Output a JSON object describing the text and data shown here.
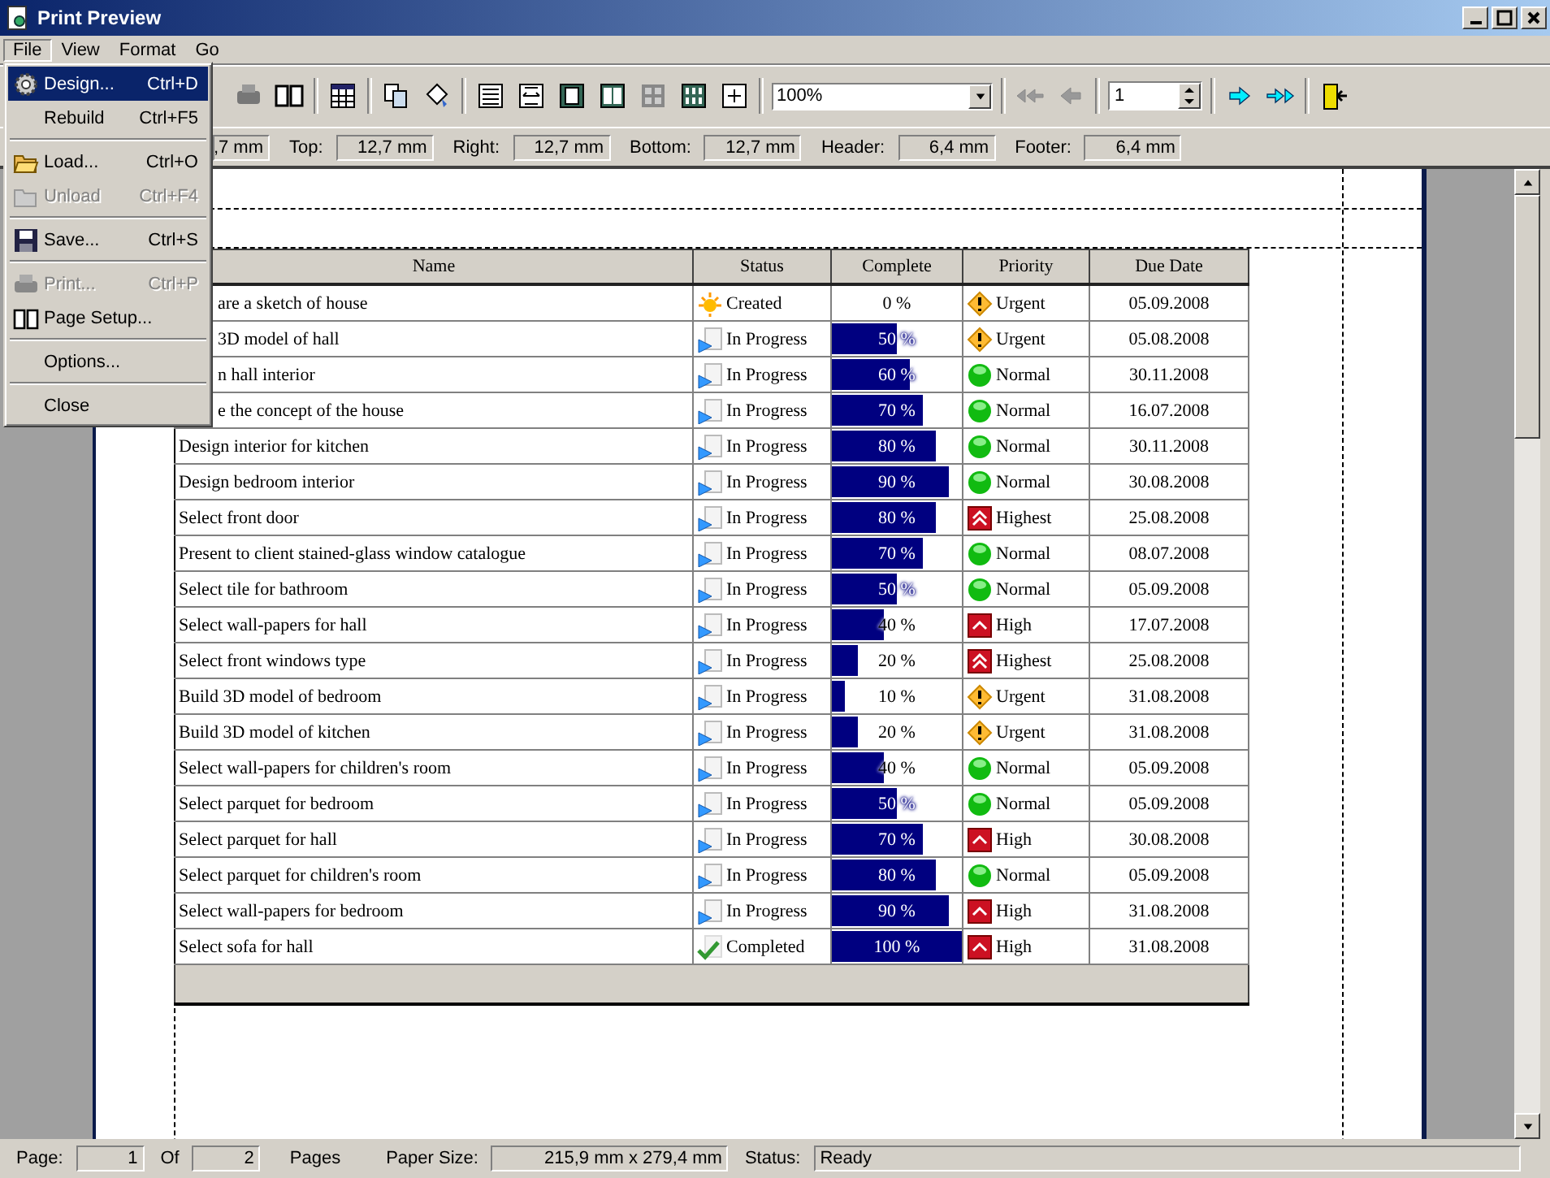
{
  "window": {
    "title": "Print Preview"
  },
  "menu_bar": [
    {
      "label": "File",
      "selected": true
    },
    {
      "label": "View",
      "selected": false
    },
    {
      "label": "Format",
      "selected": false
    },
    {
      "label": "Go",
      "selected": false
    }
  ],
  "file_menu": [
    {
      "label": "Design...",
      "shortcut": "Ctrl+D",
      "selected": true,
      "disabled": false,
      "separator_after": false
    },
    {
      "label": "Rebuild",
      "shortcut": "Ctrl+F5",
      "selected": false,
      "disabled": false,
      "separator_after": true
    },
    {
      "label": "Load...",
      "shortcut": "Ctrl+O",
      "selected": false,
      "disabled": false,
      "separator_after": false
    },
    {
      "label": "Unload",
      "shortcut": "Ctrl+F4",
      "selected": false,
      "disabled": true,
      "separator_after": true
    },
    {
      "label": "Save...",
      "shortcut": "Ctrl+S",
      "selected": false,
      "disabled": false,
      "separator_after": true
    },
    {
      "label": "Print...",
      "shortcut": "Ctrl+P",
      "selected": false,
      "disabled": true,
      "separator_after": false
    },
    {
      "label": "Page Setup...",
      "selected": false,
      "disabled": false,
      "separator_after": true
    },
    {
      "label": "Options...",
      "selected": false,
      "disabled": false,
      "separator_after": true
    },
    {
      "label": "Close",
      "selected": false,
      "disabled": false,
      "separator_after": false
    }
  ],
  "toolbar": {
    "zoom": "100%",
    "page": "1",
    "nav_buttons": [
      {
        "disabled": true
      },
      {
        "disabled": true
      },
      {
        "disabled": false
      },
      {
        "disabled": false
      }
    ]
  },
  "margins": [
    {
      "value": ",7 mm"
    },
    {
      "label": "Top:",
      "value": "12,7 mm"
    },
    {
      "label": "Right:",
      "value": "12,7 mm"
    },
    {
      "label": "Bottom:",
      "value": "12,7 mm"
    },
    {
      "label": "Header:",
      "value": "6,4 mm"
    },
    {
      "label": "Footer:",
      "value": "6,4 mm"
    }
  ],
  "table": {
    "columns": [
      "Name",
      "Status",
      "Complete",
      "Priority",
      "Due Date"
    ],
    "rows": [
      {
        "name": "are a sketch of house",
        "name_covered": true,
        "status": {
          "kind": "created",
          "label": "Created"
        },
        "complete": "0 %",
        "level": 0,
        "priority": {
          "kind": "urgent",
          "label": "Urgent"
        },
        "due": "05.09.2008"
      },
      {
        "name": "3D model of hall",
        "name_covered": true,
        "status": {
          "kind": "progress",
          "label": "In Progress"
        },
        "complete": "50 %",
        "level": 0.5,
        "priority": {
          "kind": "urgent",
          "label": "Urgent"
        },
        "due": "05.08.2008"
      },
      {
        "name": "n hall interior",
        "name_covered": true,
        "status": {
          "kind": "progress",
          "label": "In Progress"
        },
        "complete": "60 %",
        "level": 0.6,
        "priority": {
          "kind": "normal",
          "label": "Normal"
        },
        "due": "30.11.2008"
      },
      {
        "name": "e the concept of the house",
        "name_covered": true,
        "status": {
          "kind": "progress",
          "label": "In Progress"
        },
        "complete": "70 %",
        "level": 0.7,
        "priority": {
          "kind": "normal",
          "label": "Normal"
        },
        "due": "16.07.2008"
      },
      {
        "name": "Design interior for kitchen",
        "name_covered": false,
        "status": {
          "kind": "progress",
          "label": "In Progress"
        },
        "complete": "80 %",
        "level": 0.8,
        "priority": {
          "kind": "normal",
          "label": "Normal"
        },
        "due": "30.11.2008"
      },
      {
        "name": "Design bedroom interior",
        "name_covered": false,
        "status": {
          "kind": "progress",
          "label": "In Progress"
        },
        "complete": "90 %",
        "level": 0.9,
        "priority": {
          "kind": "normal",
          "label": "Normal"
        },
        "due": "30.08.2008"
      },
      {
        "name": "Select front door",
        "name_covered": false,
        "status": {
          "kind": "progress",
          "label": "In Progress"
        },
        "complete": "80 %",
        "level": 0.8,
        "priority": {
          "kind": "highest",
          "label": "Highest"
        },
        "due": "25.08.2008"
      },
      {
        "name": "Present to client stained-glass window catalogue",
        "name_covered": false,
        "status": {
          "kind": "progress",
          "label": "In Progress"
        },
        "complete": "70 %",
        "level": 0.7,
        "priority": {
          "kind": "normal",
          "label": "Normal"
        },
        "due": "08.07.2008"
      },
      {
        "name": "Select tile for bathroom",
        "name_covered": false,
        "status": {
          "kind": "progress",
          "label": "In Progress"
        },
        "complete": "50 %",
        "level": 0.5,
        "priority": {
          "kind": "normal",
          "label": "Normal"
        },
        "due": "05.09.2008"
      },
      {
        "name": "Select wall-papers for hall",
        "name_covered": false,
        "status": {
          "kind": "progress",
          "label": "In Progress"
        },
        "complete": "40 %",
        "level": 0.4,
        "priority": {
          "kind": "high",
          "label": "High"
        },
        "due": "17.07.2008"
      },
      {
        "name": "Select front windows type",
        "name_covered": false,
        "status": {
          "kind": "progress",
          "label": "In Progress"
        },
        "complete": "20 %",
        "level": 0.2,
        "priority": {
          "kind": "highest",
          "label": "Highest"
        },
        "due": "25.08.2008"
      },
      {
        "name": "Build 3D model of bedroom",
        "name_covered": false,
        "status": {
          "kind": "progress",
          "label": "In Progress"
        },
        "complete": "10 %",
        "level": 0.1,
        "priority": {
          "kind": "urgent",
          "label": "Urgent"
        },
        "due": "31.08.2008"
      },
      {
        "name": "Build 3D model of kitchen",
        "name_covered": false,
        "status": {
          "kind": "progress",
          "label": "In Progress"
        },
        "complete": "20 %",
        "level": 0.2,
        "priority": {
          "kind": "urgent",
          "label": "Urgent"
        },
        "due": "31.08.2008"
      },
      {
        "name": "Select wall-papers for children's room",
        "name_covered": false,
        "status": {
          "kind": "progress",
          "label": "In Progress"
        },
        "complete": "40 %",
        "level": 0.4,
        "priority": {
          "kind": "normal",
          "label": "Normal"
        },
        "due": "05.09.2008"
      },
      {
        "name": "Select parquet for bedroom",
        "name_covered": false,
        "status": {
          "kind": "progress",
          "label": "In Progress"
        },
        "complete": "50 %",
        "level": 0.5,
        "priority": {
          "kind": "normal",
          "label": "Normal"
        },
        "due": "05.09.2008"
      },
      {
        "name": "Select parquet for hall",
        "name_covered": false,
        "status": {
          "kind": "progress",
          "label": "In Progress"
        },
        "complete": "70 %",
        "level": 0.7,
        "priority": {
          "kind": "high",
          "label": "High"
        },
        "due": "30.08.2008"
      },
      {
        "name": "Select parquet for children's room",
        "name_covered": false,
        "status": {
          "kind": "progress",
          "label": "In Progress"
        },
        "complete": "80 %",
        "level": 0.8,
        "priority": {
          "kind": "normal",
          "label": "Normal"
        },
        "due": "05.09.2008"
      },
      {
        "name": "Select wall-papers for bedroom",
        "name_covered": false,
        "status": {
          "kind": "progress",
          "label": "In Progress"
        },
        "complete": "90 %",
        "level": 0.9,
        "priority": {
          "kind": "high",
          "label": "High"
        },
        "due": "31.08.2008"
      },
      {
        "name": "Select sofa for hall",
        "name_covered": false,
        "status": {
          "kind": "completed",
          "label": "Completed"
        },
        "complete": "100 %",
        "level": 1,
        "priority": {
          "kind": "high",
          "label": "High"
        },
        "due": "31.08.2008"
      }
    ]
  },
  "status_bar": {
    "page_label": "Page:",
    "page": "1",
    "of_label": "Of",
    "pages": "2",
    "pages_label": "Pages",
    "paper_label": "Paper Size:",
    "paper": "215,9 mm x 279,4 mm",
    "status_label": "Status:",
    "status": "Ready"
  }
}
